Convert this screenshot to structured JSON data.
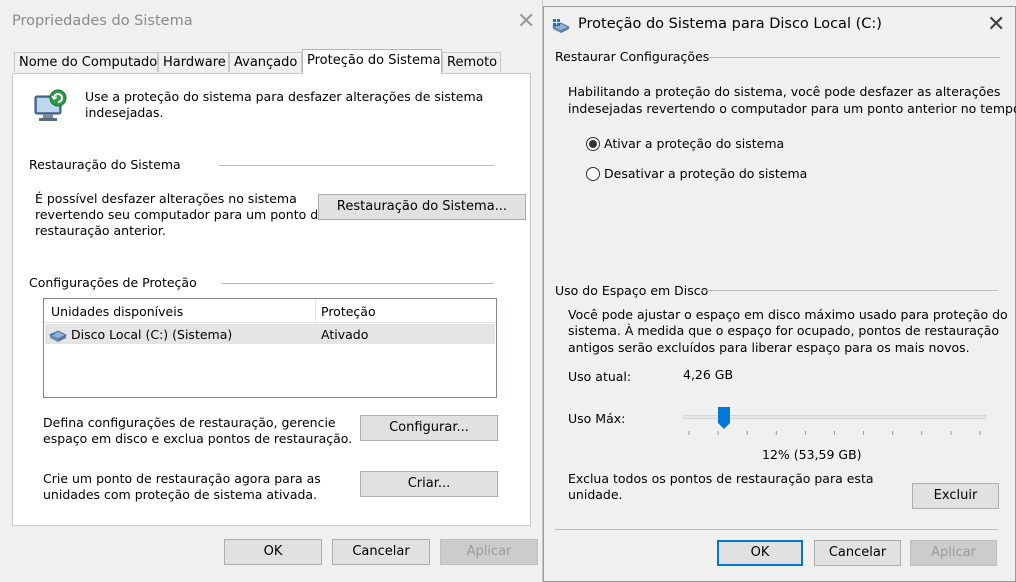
{
  "system_properties": {
    "title": "Propriedades do Sistema",
    "tabs": [
      "Nome do Computador",
      "Hardware",
      "Avançado",
      "Proteção do Sistema",
      "Remoto"
    ],
    "active_tab": "Proteção do Sistema",
    "intro_line1": "Use a proteção do sistema para desfazer alterações de sistema",
    "intro_line2": "indesejadas.",
    "restore_group_title": "Restauração do Sistema",
    "restore_desc_l1": "É possível desfazer alterações no sistema",
    "restore_desc_l2": "revertendo seu computador para um ponto de",
    "restore_desc_l3": "restauração anterior.",
    "restore_button": "Restauração do Sistema...",
    "protection_group_title": "Configurações de Proteção",
    "table": {
      "columns": [
        "Unidades disponíveis",
        "Proteção"
      ],
      "rows": [
        {
          "drive": "Disco Local (C:) (Sistema)",
          "protection": "Ativado"
        }
      ]
    },
    "configure_desc_l1": "Defina configurações de restauração, gerencie",
    "configure_desc_l2": "espaço em disco e exclua pontos de restauração.",
    "configure_button": "Configurar...",
    "create_desc_l1": "Crie um ponto de restauração agora para as",
    "create_desc_l2": "unidades com proteção de sistema ativada.",
    "create_button": "Criar...",
    "ok": "OK",
    "cancel": "Cancelar",
    "apply": "Aplicar"
  },
  "disk_protection": {
    "title": "Proteção do Sistema para Disco Local (C:)",
    "restore_settings_title": "Restaurar Configurações",
    "restore_desc_l1": "Habilitando a proteção do sistema, você pode desfazer as alterações",
    "restore_desc_l2": "indesejadas revertendo o computador para um ponto anterior no tempo.",
    "radio_on": "Ativar a proteção do sistema",
    "radio_off": "Desativar a proteção do sistema",
    "selected_option": "Ativar a proteção do sistema",
    "disk_usage_title": "Uso do Espaço em Disco",
    "usage_desc_l1": "Você pode ajustar o espaço em disco máximo usado para proteção do",
    "usage_desc_l2": "sistema. À medida que o espaço for ocupado, pontos de restauração",
    "usage_desc_l3": "antigos serão excluídos para liberar espaço para os mais novos.",
    "current_usage_label": "Uso atual:",
    "current_usage_value": "4,26 GB",
    "max_usage_label": "Uso Máx:",
    "max_usage_percent": 12,
    "max_usage_text": "12% (53,59 GB)",
    "delete_desc_l1": "Exclua todos os pontos de restauração para esta",
    "delete_desc_l2": "unidade.",
    "delete_button": "Excluir",
    "ok": "OK",
    "cancel": "Cancelar",
    "apply": "Aplicar"
  },
  "colors": {
    "focus_border": "#0078d7",
    "slider_thumb": "#0078d7",
    "disabled_text": "#9c9c9c"
  }
}
